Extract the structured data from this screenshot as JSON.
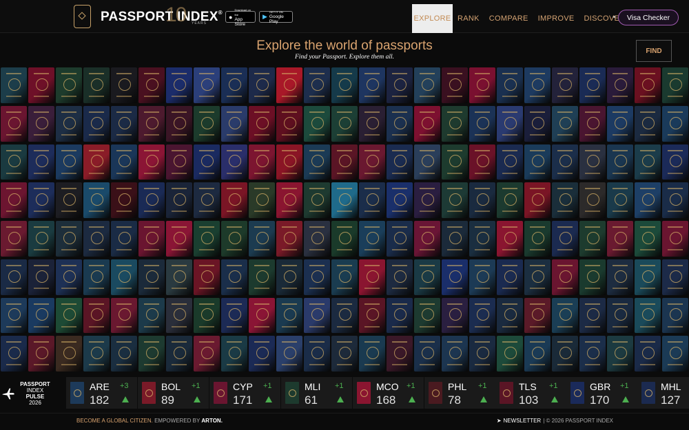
{
  "header": {
    "logo_passport": "PASSPORT",
    "logo_index": "INDEX",
    "logo_reg": "®",
    "logo_ten": "10",
    "logo_years": "YEARS",
    "appstore_small": "Download on the",
    "appstore_big": "App Store",
    "googleplay_small": "GET IT ON",
    "googleplay_big": "Google Play",
    "nav": [
      "EXPLORE",
      "RANK",
      "COMPARE",
      "IMPROVE",
      "DISCOVER"
    ],
    "visa_checker": "Visa Checker"
  },
  "main": {
    "title": "Explore the world of passports",
    "subtitle": "Find your Passport. Explore them all.",
    "find_button": "FIND"
  },
  "passport_colors": [
    "#1c3d4a",
    "#6e1028",
    "#1d3b2c",
    "#1a2f28",
    "#1a1a1f",
    "#4a1020",
    "#1b2c6a",
    "#2b3f7a",
    "#1a2e55",
    "#1d2a4a",
    "#a81828",
    "#1d2e4d",
    "#153a4a",
    "#1e3560",
    "#1c2340",
    "#23405a",
    "#3a1020",
    "#7a1030",
    "#1a3050",
    "#1d3a60",
    "#23223a",
    "#1a2b55",
    "#2a1b3a",
    "#6a1020",
    "#1a3a2f",
    "#6a1530",
    "#3a1e3a",
    "#1d2e44",
    "#1a2a4a",
    "#1b2a45",
    "#4d1a2e",
    "#3a1525",
    "#1c3b2c",
    "#2a3b6a",
    "#6c0f25",
    "#5e0f1f",
    "#1c4a3c",
    "#1c3f35",
    "#2a1f33",
    "#1b304f",
    "#7d1030",
    "#1e3a2e",
    "#1b3256",
    "#2a3a70",
    "#1a1e3a",
    "#1f3f55",
    "#4a1530",
    "#1c3a62",
    "#1b2a40",
    "#1a3a5a",
    "#1a3a40",
    "#1d2c5a",
    "#1b3a5f",
    "#8a1c28",
    "#1a3658",
    "#8b1535",
    "#4a1530",
    "#1a2a60",
    "#2a2e6a",
    "#7c1530",
    "#8a1525",
    "#1b3a55",
    "#5a1525",
    "#6a1830",
    "#1a2b50",
    "#2a3e5a",
    "#1d3b2e",
    "#6a1228",
    "#1a2a50",
    "#1a3b5a",
    "#1b2e4a",
    "#2a3040",
    "#1a3650",
    "#1b3c4a",
    "#1b2a58",
    "#6c1530",
    "#1d2d5a",
    "#1d1d22",
    "#1a4a6a",
    "#3a1018",
    "#1a2a55",
    "#1a2438",
    "#1d2a40",
    "#7a1525",
    "#2a3a28",
    "#8a1530",
    "#1e3a30",
    "#1f6a8a",
    "#1b2d4a",
    "#1a2f6a",
    "#2a1e40",
    "#1d3a35",
    "#1a2a3f",
    "#1c3a2f",
    "#7a1525",
    "#1a2e3a",
    "#2c2a2a",
    "#1a3a4a",
    "#1d3f66",
    "#1a2c48",
    "#6a1a30",
    "#1a3b40",
    "#1d2e3a",
    "#1c2a40",
    "#1a2b45",
    "#6a1530",
    "#8a1535",
    "#1a3f30",
    "#1d3a2a",
    "#1c3b50",
    "#7a1a28",
    "#2a3040",
    "#1a3a2a",
    "#1a3e5a",
    "#1a2c4a",
    "#6a1535",
    "#1b2a3a",
    "#1a2e40",
    "#8a1530",
    "#1a3a2e",
    "#1b2a50",
    "#1d3b2e",
    "#6a1a30",
    "#1c4a3a",
    "#6a1530",
    "#1a2a45",
    "#1b2238",
    "#1d3055",
    "#1a3a50",
    "#1a4a60",
    "#1b2a3a",
    "#2a3a40",
    "#6a1525",
    "#1a2e4a",
    "#1c3a2e",
    "#1a2a38",
    "#1b2f50",
    "#1a3c50",
    "#8a1530",
    "#1d2a40",
    "#1a3a45",
    "#1a2e6a",
    "#1c3a55",
    "#1a2a50",
    "#1b2e40",
    "#6a1530",
    "#1a3a2e",
    "#1d2c40",
    "#1a4a5a",
    "#1c2a48",
    "#1d3a5a",
    "#1a3a60",
    "#1d4a35",
    "#5a1525",
    "#6a1830",
    "#1c3a4a",
    "#2a2e3a",
    "#1a3a2a",
    "#1c2a55",
    "#8a1535",
    "#1a3a50",
    "#2a3a6a",
    "#1b2a40",
    "#5a1525",
    "#1a2a4a",
    "#1d3a30",
    "#2a1f40",
    "#1b2c50",
    "#1a2a3f",
    "#5a1a28",
    "#1a3e55",
    "#1c2a45",
    "#1a2a40",
    "#1a4a5a",
    "#1b3550",
    "#1a2a4a",
    "#5a1828",
    "#3a2a20",
    "#1c3a4a",
    "#1a2e40",
    "#1d3a30",
    "#1a2a3a",
    "#6a1a30",
    "#1a3a45",
    "#1b2a55",
    "#2a3f6a",
    "#1a2c48",
    "#1d2a3a",
    "#1a3a50",
    "#3a1828",
    "#1a2f4a",
    "#1c3550",
    "#1a2a40",
    "#1d4a3a",
    "#1a3a55",
    "#1a2a38",
    "#1b2e4a",
    "#1c3a40",
    "#1a2a48",
    "#1b3a55"
  ],
  "pulse": {
    "label_line1": "PASSPORT",
    "label_line2": "INDEX",
    "label_line3": "PULSE",
    "label_line4": "2026",
    "items": [
      {
        "code": "ARE",
        "score": "182",
        "delta": "+3",
        "color": "#1d3a5a"
      },
      {
        "code": "BOL",
        "score": "89",
        "delta": "+1",
        "color": "#7a1a28"
      },
      {
        "code": "CYP",
        "score": "171",
        "delta": "+1",
        "color": "#6a1530"
      },
      {
        "code": "MLI",
        "score": "61",
        "delta": "+1",
        "color": "#1d3a2e"
      },
      {
        "code": "MCO",
        "score": "168",
        "delta": "+1",
        "color": "#8a1530"
      },
      {
        "code": "PHL",
        "score": "78",
        "delta": "+1",
        "color": "#4a1a20"
      },
      {
        "code": "TLS",
        "score": "103",
        "delta": "+1",
        "color": "#5a1525"
      },
      {
        "code": "GBR",
        "score": "170",
        "delta": "+1",
        "color": "#1a2a5a"
      },
      {
        "code": "MHL",
        "score": "127",
        "delta": "",
        "color": "#1b2a50"
      }
    ]
  },
  "footer": {
    "left_gold": "BECOME A GLOBAL CITIZEN.",
    "left_gray": "EMPOWERED BY",
    "left_brand": "ARTON.",
    "newsletter": "NEWSLETTER",
    "copyright": "| © 2026 PASSPORT INDEX"
  }
}
